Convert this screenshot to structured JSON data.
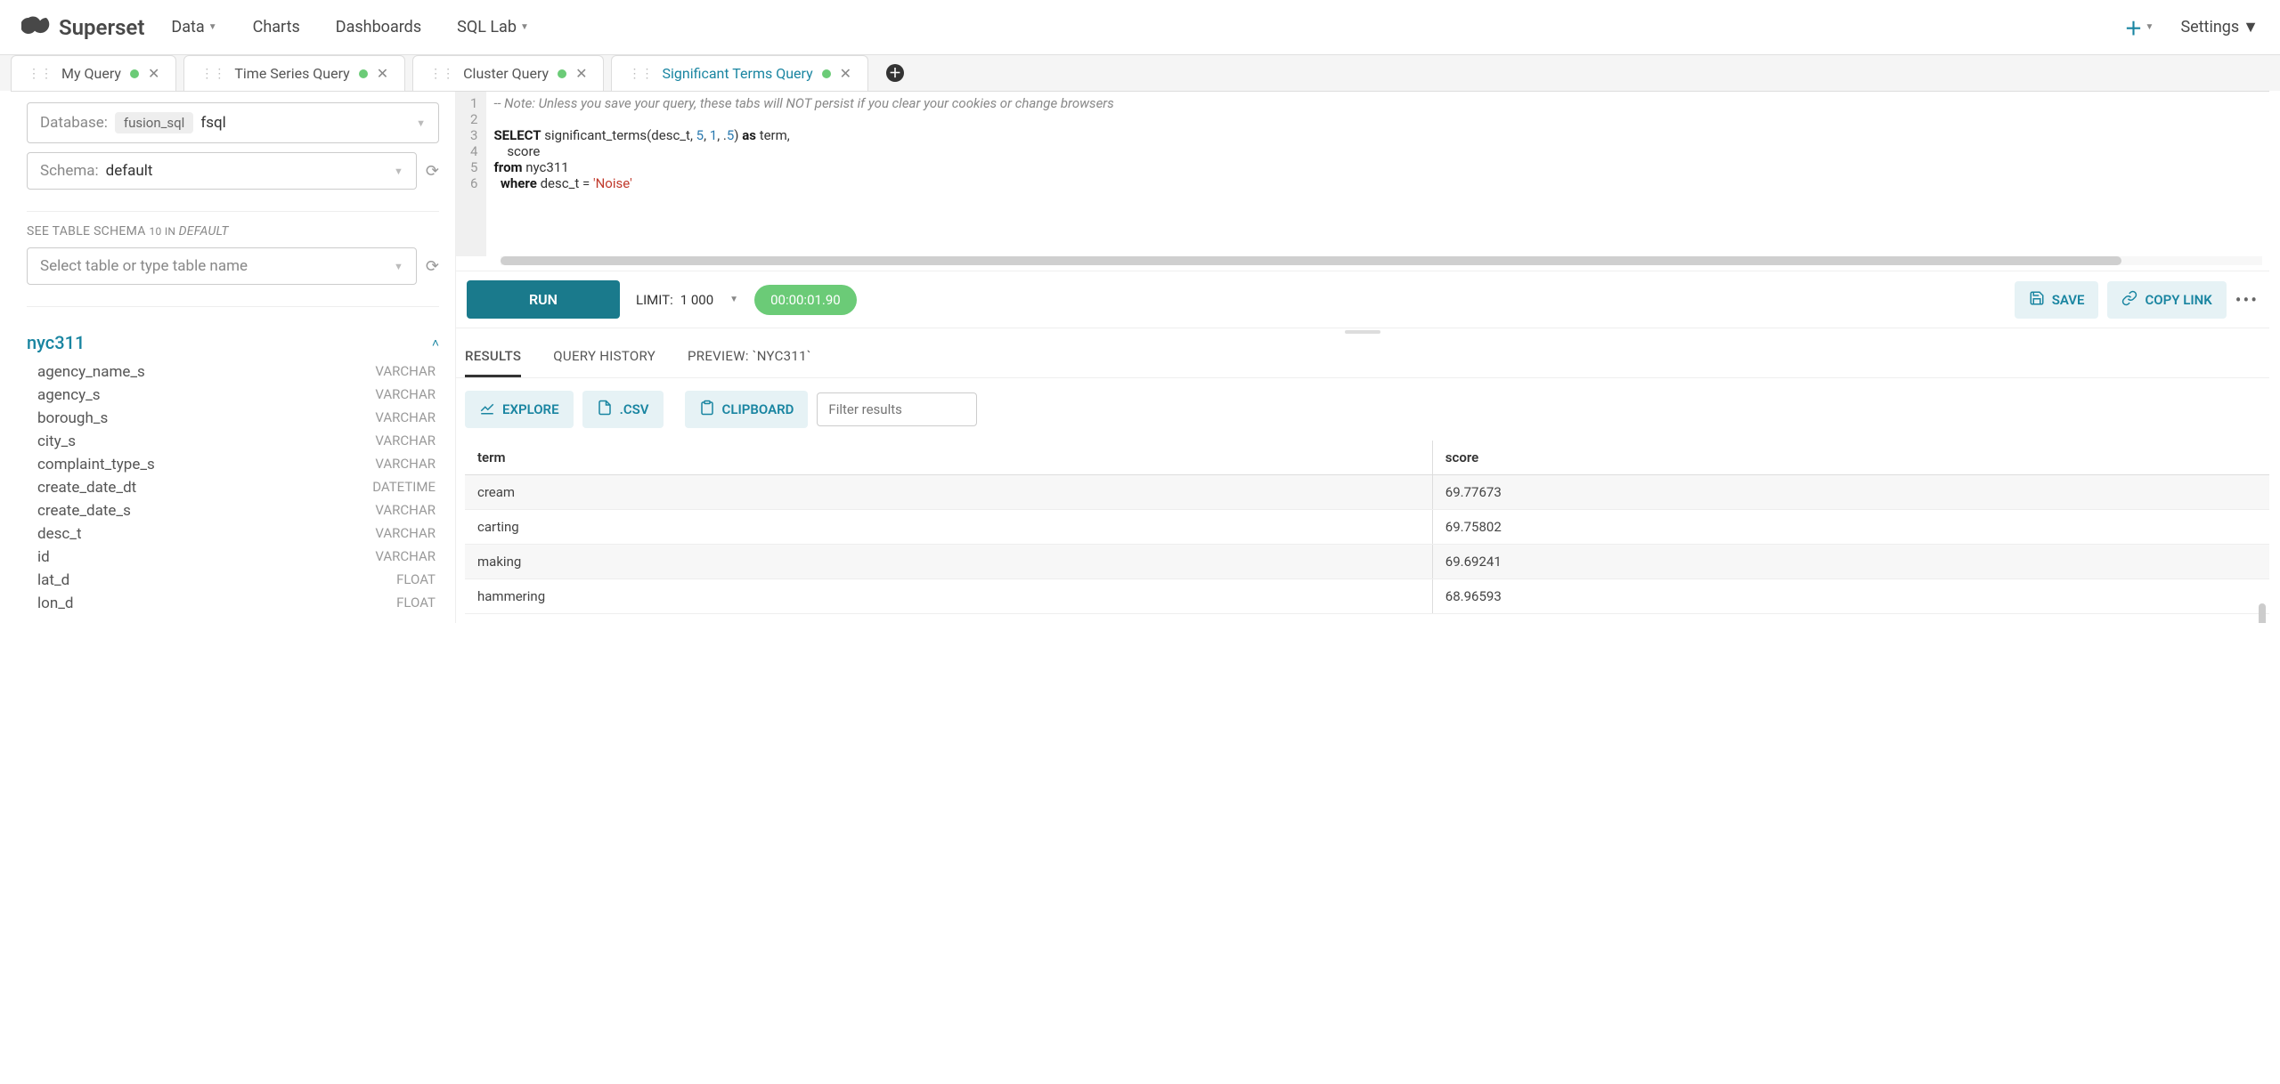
{
  "brand": "Superset",
  "nav": {
    "data": "Data",
    "charts": "Charts",
    "dashboards": "Dashboards",
    "sqllab": "SQL Lab",
    "settings": "Settings"
  },
  "tabs": [
    {
      "label": "My Query"
    },
    {
      "label": "Time Series Query"
    },
    {
      "label": "Cluster Query"
    },
    {
      "label": "Significant Terms Query",
      "active": true
    }
  ],
  "left": {
    "database_label": "Database:",
    "database_chip": "fusion_sql",
    "database_value": "fsql",
    "schema_label": "Schema:",
    "schema_value": "default",
    "see_schema_prefix": "SEE TABLE SCHEMA ",
    "see_schema_count": "10 IN ",
    "see_schema_db": "DEFAULT",
    "table_placeholder": "Select table or type table name",
    "table_name": "nyc311",
    "columns": [
      {
        "name": "agency_name_s",
        "type": "VARCHAR"
      },
      {
        "name": "agency_s",
        "type": "VARCHAR"
      },
      {
        "name": "borough_s",
        "type": "VARCHAR"
      },
      {
        "name": "city_s",
        "type": "VARCHAR"
      },
      {
        "name": "complaint_type_s",
        "type": "VARCHAR"
      },
      {
        "name": "create_date_dt",
        "type": "DATETIME"
      },
      {
        "name": "create_date_s",
        "type": "VARCHAR"
      },
      {
        "name": "desc_t",
        "type": "VARCHAR"
      },
      {
        "name": "id",
        "type": "VARCHAR"
      },
      {
        "name": "lat_d",
        "type": "FLOAT"
      },
      {
        "name": "lon_d",
        "type": "FLOAT"
      }
    ]
  },
  "editor": {
    "comment": "-- Note: Unless you save your query, these tabs will NOT persist if you clear your cookies or change browsers",
    "line3_a": "SELECT",
    "line3_b": " significant_terms(desc_t, ",
    "line3_n1": "5",
    "line3_c": ", ",
    "line3_n2": "1",
    "line3_d": ", .",
    "line3_n3": "5",
    "line3_e": ") ",
    "line3_f": "as",
    "line3_g": " term,",
    "line4": "    score",
    "line5_a": "from",
    "line5_b": " nyc311",
    "line6_a": "  ",
    "line6_b": "where",
    "line6_c": " desc_t = ",
    "line6_d": "'Noise'"
  },
  "runbar": {
    "run": "RUN",
    "limit_label": "LIMIT:",
    "limit_value": "1 000",
    "timer": "00:00:01.90",
    "save": "SAVE",
    "copylink": "COPY LINK"
  },
  "result_tabs": {
    "results": "RESULTS",
    "history": "QUERY HISTORY",
    "preview": "PREVIEW: `NYC311`"
  },
  "result_toolbar": {
    "explore": "EXPLORE",
    "csv": ".CSV",
    "clipboard": "CLIPBOARD",
    "filter_placeholder": "Filter results"
  },
  "results": {
    "headers": [
      "term",
      "score"
    ],
    "rows": [
      [
        "cream",
        "69.77673"
      ],
      [
        "carting",
        "69.75802"
      ],
      [
        "making",
        "69.69241"
      ],
      [
        "hammering",
        "68.96593"
      ]
    ]
  }
}
